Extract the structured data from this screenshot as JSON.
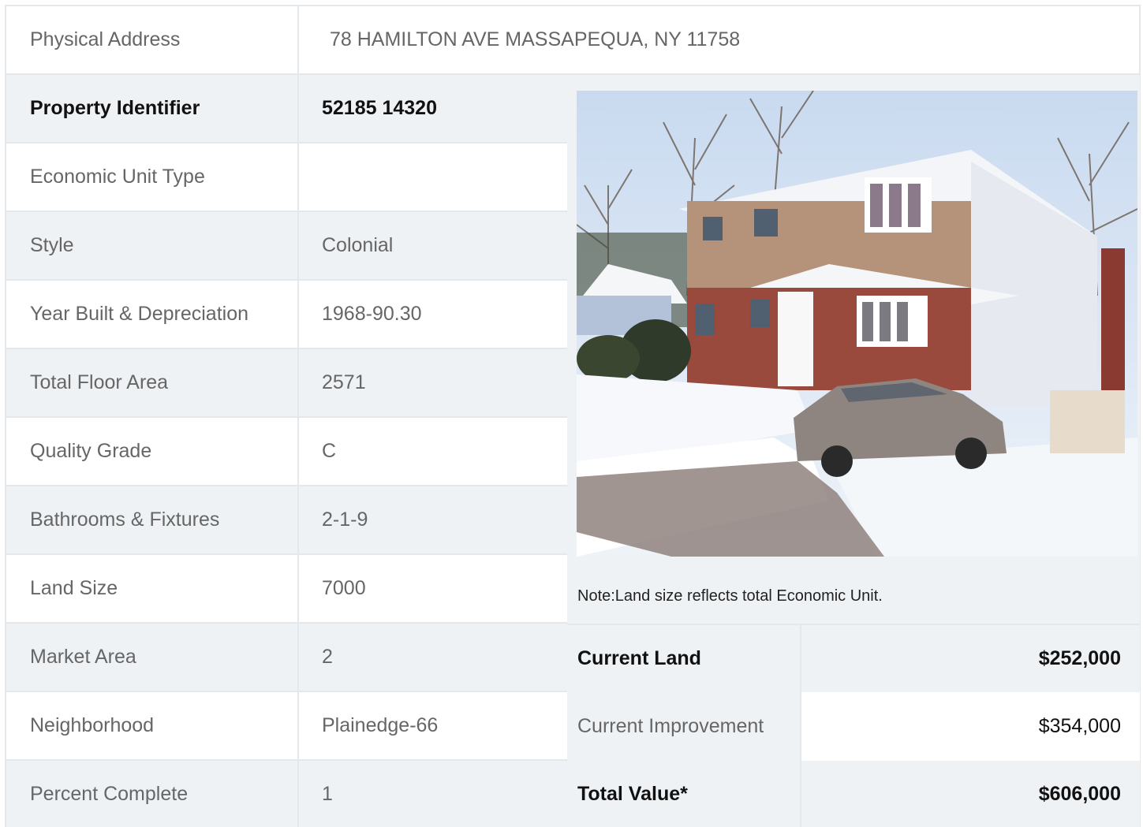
{
  "address": {
    "label": "Physical Address",
    "value": "78  HAMILTON AVE  MASSAPEQUA, NY  11758"
  },
  "properties": [
    {
      "label": "Property Identifier",
      "value": "52185  14320"
    },
    {
      "label": "Economic Unit Type",
      "value": ""
    },
    {
      "label": "Style",
      "value": "Colonial"
    },
    {
      "label": "Year Built & Depreciation",
      "value": "1968-90.30"
    },
    {
      "label": "Total Floor Area",
      "value": "2571"
    },
    {
      "label": "Quality Grade",
      "value": "C"
    },
    {
      "label": "Bathrooms & Fixtures",
      "value": "2-1-9"
    },
    {
      "label": "Land Size",
      "value": "7000"
    },
    {
      "label": "Market Area",
      "value": "2"
    },
    {
      "label": "Neighborhood",
      "value": "Plainedge-66"
    },
    {
      "label": "Percent Complete",
      "value": "1"
    }
  ],
  "note": "Note:Land size reflects total Economic Unit.",
  "values": [
    {
      "label": "Current Land",
      "value": "$252,000"
    },
    {
      "label": "Current Improvement",
      "value": "$354,000"
    },
    {
      "label": "Total Value*",
      "value": "$606,000"
    }
  ],
  "colors": {
    "row_grey": "#eff2f5",
    "border": "#e3e8ec",
    "text": "#666666",
    "bold_text": "#111111"
  }
}
